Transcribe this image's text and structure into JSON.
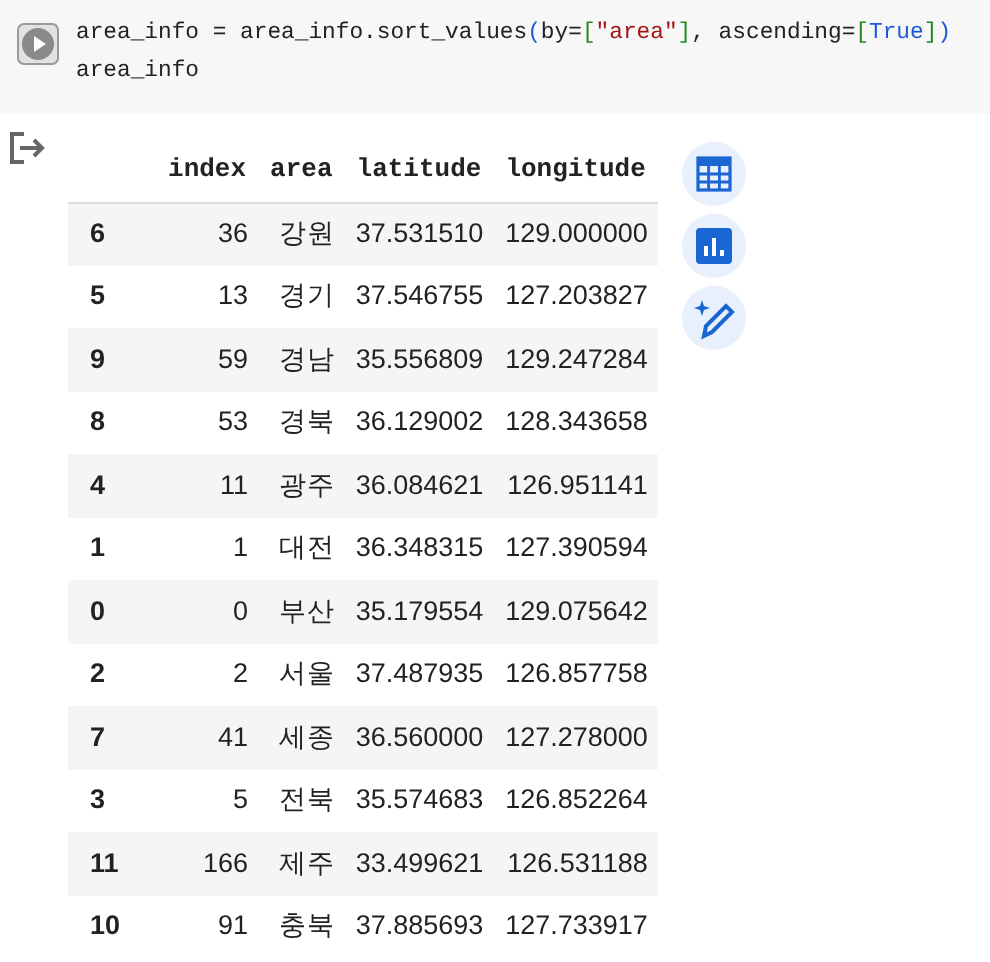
{
  "code_cell": {
    "lines": [
      [
        {
          "kind": "plain",
          "text": "area_info = area_info.sort_values"
        },
        {
          "kind": "paren",
          "text": "("
        },
        {
          "kind": "plain",
          "text": "by="
        },
        {
          "kind": "bracket",
          "text": "["
        },
        {
          "kind": "string",
          "text": "\"area\""
        },
        {
          "kind": "bracket",
          "text": "]"
        },
        {
          "kind": "plain",
          "text": ", ascending="
        },
        {
          "kind": "bracket",
          "text": "["
        },
        {
          "kind": "keyword",
          "text": "True"
        },
        {
          "kind": "bracket",
          "text": "]"
        },
        {
          "kind": "paren",
          "text": ")"
        }
      ],
      [
        {
          "kind": "plain",
          "text": "area_info"
        }
      ]
    ]
  },
  "output": {
    "table": {
      "columns": [
        "index",
        "area",
        "latitude",
        "longitude"
      ],
      "rows": [
        {
          "label": "6",
          "cells": [
            "36",
            "강원",
            "37.531510",
            "129.000000"
          ]
        },
        {
          "label": "5",
          "cells": [
            "13",
            "경기",
            "37.546755",
            "127.203827"
          ]
        },
        {
          "label": "9",
          "cells": [
            "59",
            "경남",
            "35.556809",
            "129.247284"
          ]
        },
        {
          "label": "8",
          "cells": [
            "53",
            "경북",
            "36.129002",
            "128.343658"
          ]
        },
        {
          "label": "4",
          "cells": [
            "11",
            "광주",
            "36.084621",
            "126.951141"
          ]
        },
        {
          "label": "1",
          "cells": [
            "1",
            "대전",
            "36.348315",
            "127.390594"
          ]
        },
        {
          "label": "0",
          "cells": [
            "0",
            "부산",
            "35.179554",
            "129.075642"
          ]
        },
        {
          "label": "2",
          "cells": [
            "2",
            "서울",
            "37.487935",
            "126.857758"
          ]
        },
        {
          "label": "7",
          "cells": [
            "41",
            "세종",
            "36.560000",
            "127.278000"
          ]
        },
        {
          "label": "3",
          "cells": [
            "5",
            "전북",
            "35.574683",
            "126.852264"
          ]
        },
        {
          "label": "11",
          "cells": [
            "166",
            "제주",
            "33.499621",
            "126.531188"
          ]
        },
        {
          "label": "10",
          "cells": [
            "91",
            "충북",
            "37.885693",
            "127.733917"
          ]
        }
      ]
    },
    "actions": [
      {
        "kind": "table"
      },
      {
        "kind": "chart"
      },
      {
        "kind": "magic"
      }
    ]
  }
}
